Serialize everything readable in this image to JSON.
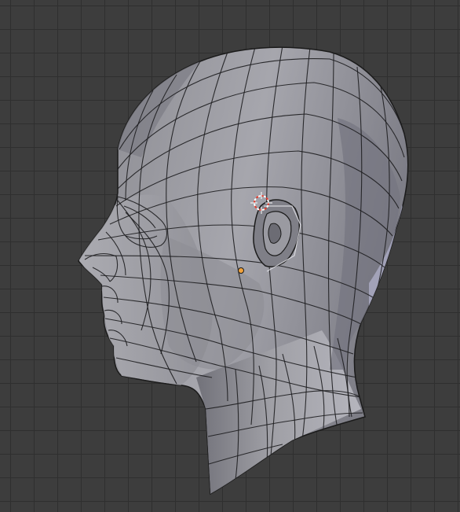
{
  "viewport": {
    "view": "3d-viewport",
    "mode": "edit-mode-wireframe-overlay",
    "show_grid": true
  },
  "scene": {
    "object": "head-mesh",
    "mesh_color": "#9d9da3",
    "wire_color": "#1b1b1b",
    "background_color": "#3d3d3d",
    "grid_color": "#2f2f2f",
    "icons": [
      "3d-cursor-icon",
      "object-origin-icon"
    ],
    "origin_color": "#f2a23a",
    "cursor_colors": [
      "#e33a2b",
      "#ffffff"
    ]
  }
}
